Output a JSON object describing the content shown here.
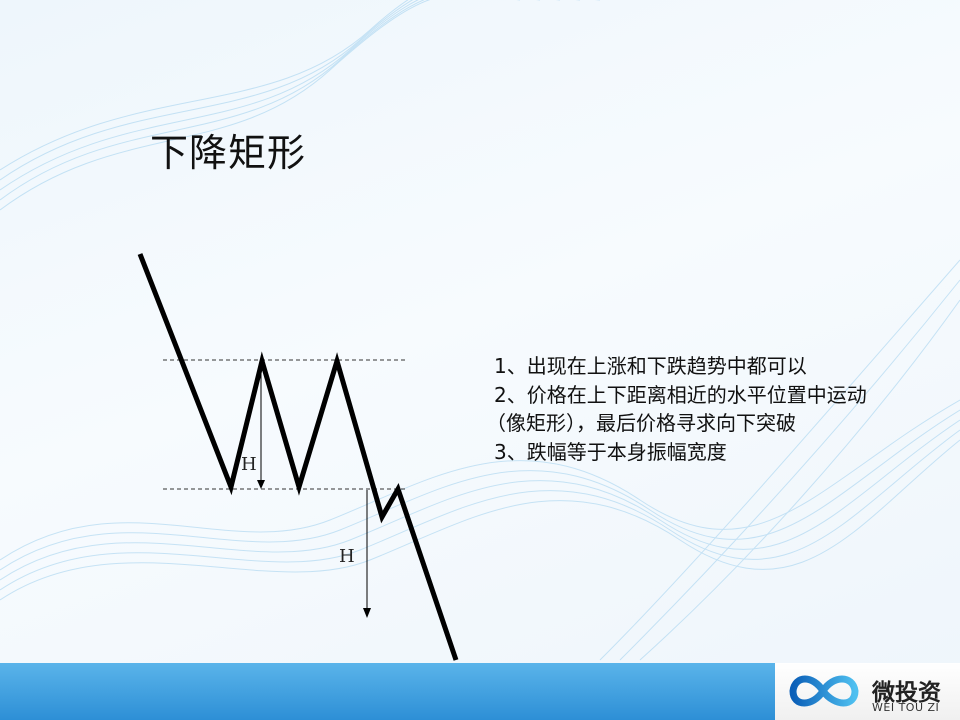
{
  "slide": {
    "title": "下降矩形",
    "points": [
      "1、出现在上涨和下跌趋势中都可以",
      "2、价格在上下距离相近的水平位置中运动",
      "（像矩形），最后价格寻求向下突破",
      "3、跌幅等于本身振幅宽度"
    ]
  },
  "diagram": {
    "height_label_1": "H",
    "height_label_2": "H",
    "line_color": "#000000"
  },
  "footer": {
    "brand_cn": "微投资",
    "brand_en": "WEI TOU ZI",
    "bar_color": "#3a9be0"
  }
}
